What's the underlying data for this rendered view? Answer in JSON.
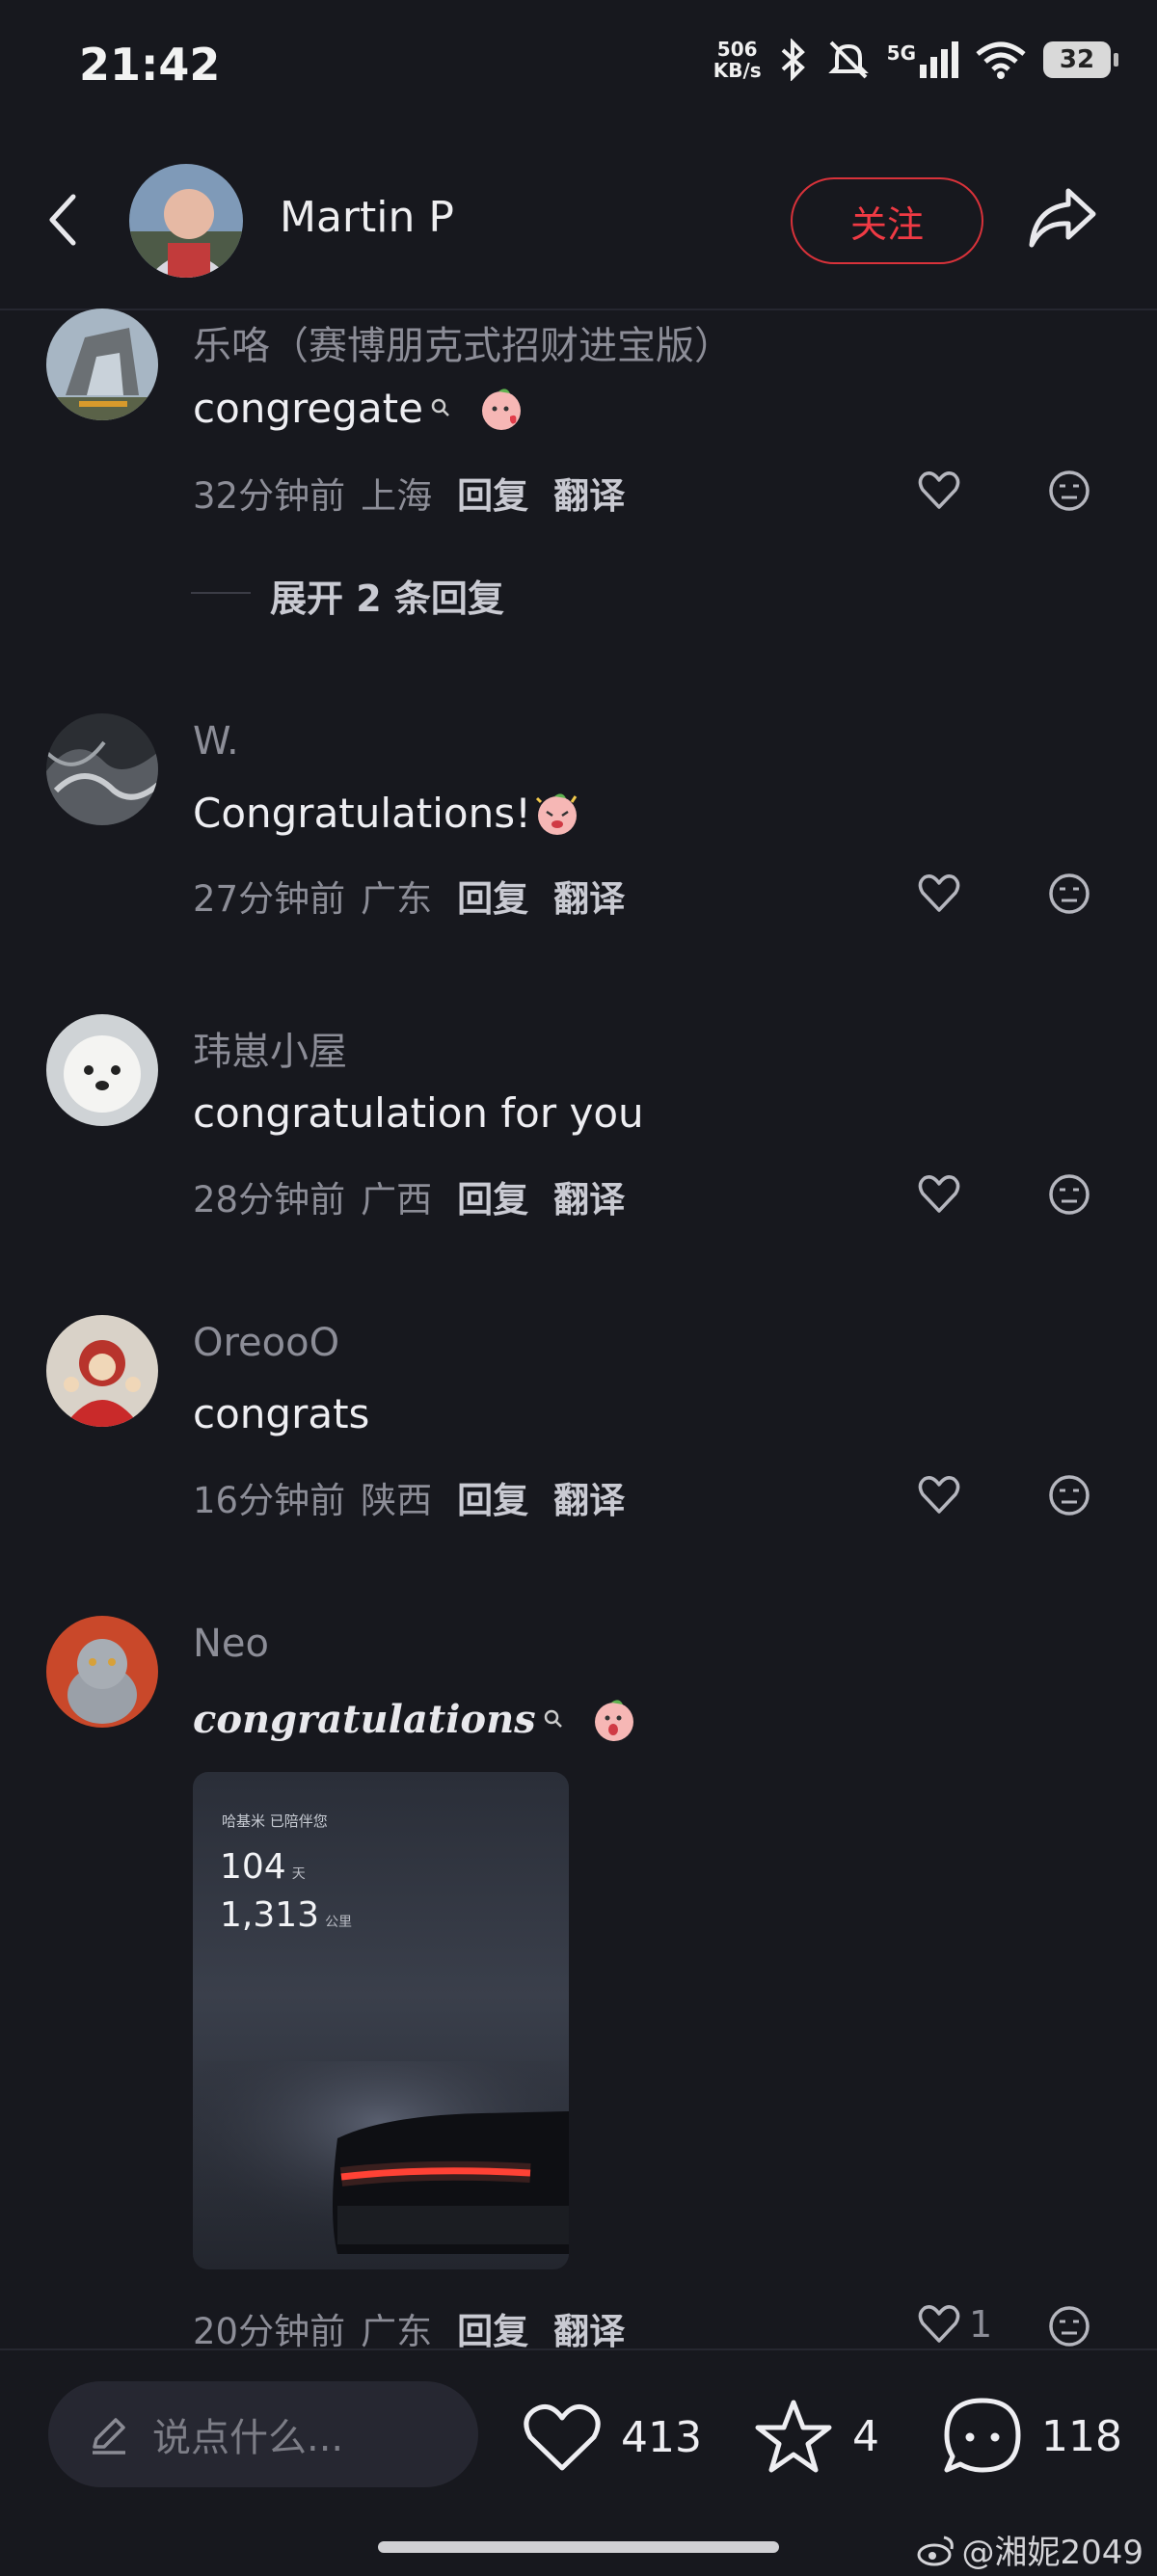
{
  "status_bar": {
    "time": "21:42",
    "net_speed_value": "506",
    "net_speed_unit": "KB/s",
    "network": "5G",
    "battery": "32"
  },
  "header": {
    "user_name": "Martin P",
    "follow_label": "关注"
  },
  "comments": [
    {
      "name": "乐咯（赛博朋克式招财进宝版）",
      "text": "congregate",
      "time": "32分钟前",
      "location": "上海",
      "reply": "回复",
      "translate": "翻译",
      "expand": "展开 2 条回复"
    },
    {
      "name": "W.",
      "text": "Congratulations!",
      "time": "27分钟前",
      "location": "广东",
      "reply": "回复",
      "translate": "翻译"
    },
    {
      "name": "玮崽小屋",
      "text": "congratulation for you",
      "time": "28分钟前",
      "location": "广西",
      "reply": "回复",
      "translate": "翻译"
    },
    {
      "name": "OreooO",
      "text": "congrats",
      "time": "16分钟前",
      "location": "陕西",
      "reply": "回复",
      "translate": "翻译"
    },
    {
      "name": "Neo",
      "text": "congratulations",
      "time": "20分钟前",
      "location": "广东",
      "reply": "回复",
      "translate": "翻译",
      "likes": "1",
      "image": {
        "caption": "哈基米 已陪伴您",
        "days_value": "104",
        "days_unit": "天",
        "km_value": "1,313",
        "km_unit": "公里"
      }
    }
  ],
  "bottom_bar": {
    "input_placeholder": "说点什么...",
    "likes": "413",
    "favorites": "4",
    "comments": "118"
  },
  "watermark": "@湘妮2049",
  "colors": {
    "background": "#17181e",
    "accent": "#f03a44",
    "muted_text": "#8c8d97"
  }
}
